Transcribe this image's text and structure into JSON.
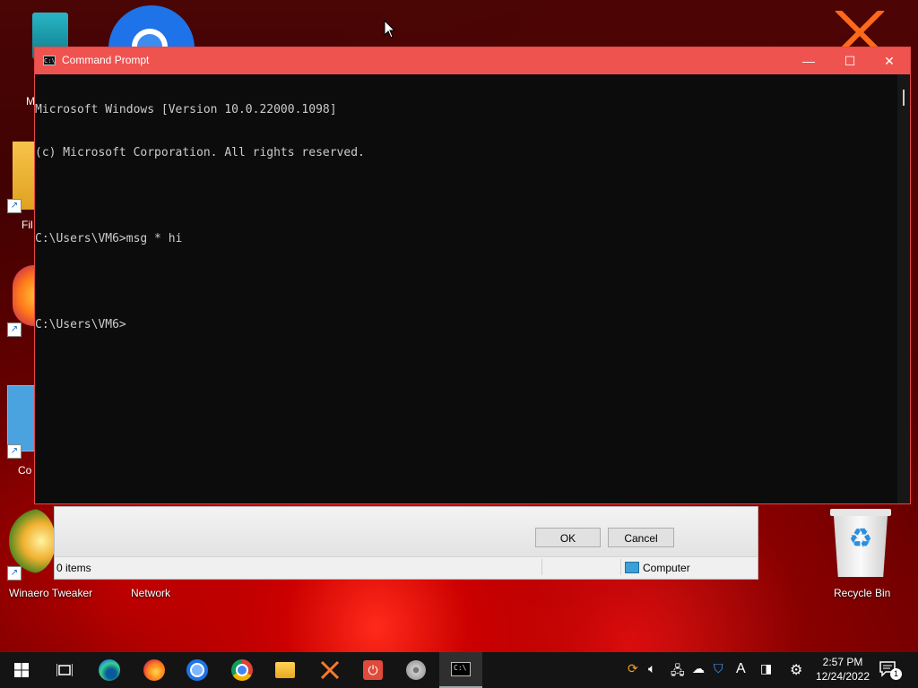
{
  "console": {
    "title": "Command Prompt",
    "minimize": "—",
    "maximize": "☐",
    "close": "✕",
    "lines": [
      "Microsoft Windows [Version 10.0.22000.1098]",
      "(c) Microsoft Corporation. All rights reserved.",
      "",
      "C:\\Users\\VM6>msg * hi",
      "",
      "C:\\Users\\VM6>"
    ]
  },
  "dialog": {
    "ok_label": "OK",
    "cancel_label": "Cancel",
    "status_items": "0 items",
    "status_location": "Computer"
  },
  "desktop": {
    "icons": [
      {
        "label": "Winaero Tweaker",
        "icon": "winaero-icon"
      },
      {
        "label": "Network",
        "icon": "network-icon"
      },
      {
        "label": "Recycle Bin",
        "icon": "recycle-bin-icon"
      }
    ],
    "partial_labels": [
      "M",
      "Fil",
      "Co"
    ]
  },
  "taskbar": {
    "apps": [
      "start",
      "task-view",
      "edge",
      "firefox",
      "chromium",
      "chrome",
      "file-explorer",
      "winaero-x",
      "power-app",
      "disc-app",
      "terminal"
    ],
    "clock_time": "2:57 PM",
    "clock_date": "12/24/2022",
    "notification_count": "1"
  },
  "colors": {
    "titlebar": "#ef5350",
    "console_bg": "#0c0c0c",
    "console_text": "#cccccc"
  }
}
